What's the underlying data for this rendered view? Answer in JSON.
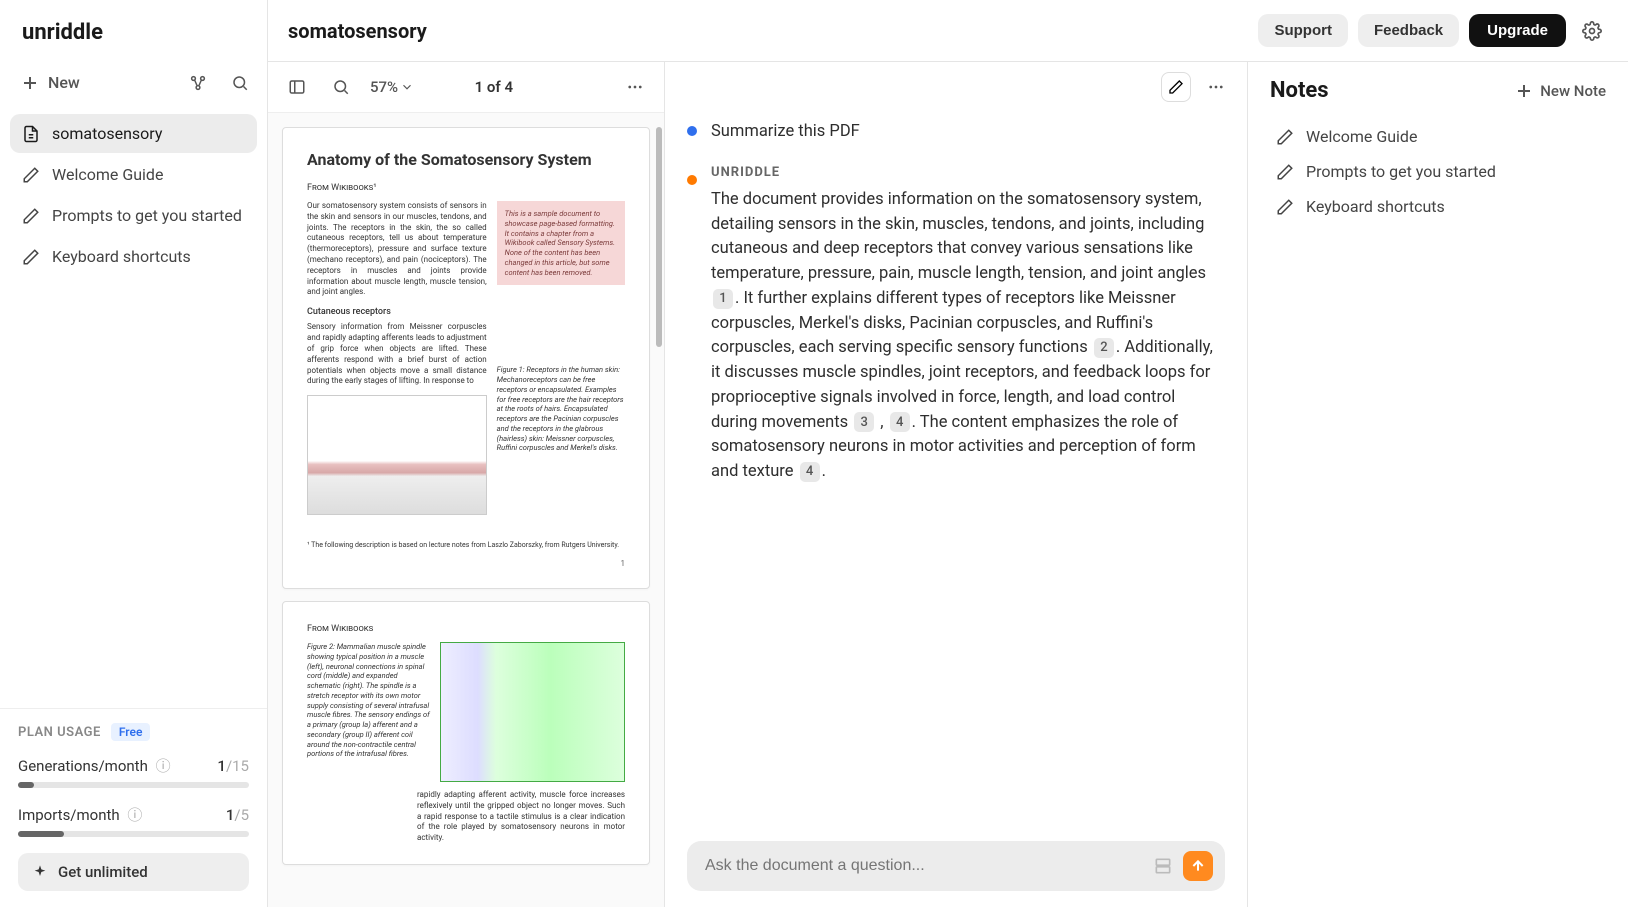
{
  "brand": "unriddle",
  "sidebar": {
    "new_label": "New",
    "items": [
      {
        "label": "somatosensory",
        "icon": "document",
        "active": true
      },
      {
        "label": "Welcome Guide",
        "icon": "pencil",
        "active": false
      },
      {
        "label": "Prompts to get you started",
        "icon": "pencil",
        "active": false
      },
      {
        "label": "Keyboard shortcuts",
        "icon": "pencil",
        "active": false
      }
    ],
    "plan_usage_label": "PLAN USAGE",
    "plan_badge": "Free",
    "generations_label": "Generations/month",
    "generations_used": "1",
    "generations_max": "/15",
    "generations_pct": 7,
    "imports_label": "Imports/month",
    "imports_used": "1",
    "imports_max": "/5",
    "imports_pct": 20,
    "get_unlimited": "Get unlimited"
  },
  "header": {
    "title": "somatosensory",
    "support": "Support",
    "feedback": "Feedback",
    "upgrade": "Upgrade"
  },
  "pdf": {
    "zoom": "57%",
    "page_indicator": "1 of 4",
    "page1": {
      "title": "Anatomy of the Somatosensory System",
      "subtitle": "From Wikibooks¹",
      "intro": "Our somatosensory system consists of sensors in the skin and sensors in our muscles, tendons, and joints. The receptors in the skin, the so called cutaneous receptors, tell us about temperature (thermoreceptors), pressure and surface texture (mechano receptors), and pain (nociceptors). The receptors in muscles and joints provide information about muscle length, muscle tension, and joint angles.",
      "note": "This is a sample document to showcase page-based formatting. It contains a chapter from a Wikibook called Sensory Systems. None of the content has been changed in this article, but some content has been removed.",
      "section1": "Cutaneous receptors",
      "section1_body": "Sensory information from Meissner corpuscles and rapidly adapting afferents leads to adjustment of grip force when objects are lifted. These afferents respond with a brief burst of action potentials when objects move a small distance during the early stages of lifting. In response to",
      "fig1_caption": "Figure 1:  Receptors in the human skin: Mechanoreceptors can be free receptors or encapsulated. Examples for free receptors are the hair receptors at the roots of hairs. Encapsulated receptors are the Pacinian corpuscles and the receptors in the glabrous (hairless) skin: Meissner corpuscles, Ruffini corpuscles and Merkel's disks.",
      "footnote": "¹ The following description is based on lecture notes from Laszlo Zaborszky, from Rutgers University.",
      "pgnum": "1"
    },
    "page2": {
      "subtitle": "From Wikibooks",
      "fig2_caption": "Figure 2:  Mammalian muscle spindle showing typical position in a muscle (left), neuronal connections in spinal cord (middle) and expanded schematic (right). The spindle is a stretch receptor with its own motor supply consisting of several intrafusal muscle fibres. The sensory endings of a primary (group Ia) afferent and a secondary (group II) afferent coil around the non-contractile central portions of the intrafusal fibres.",
      "body_cont": "rapidly adapting afferent activity, muscle force increases reflexively until the gripped object no longer moves. Such a rapid response to a tactile stimulus is a clear indication of the role played by somatosensory neurons in motor activity."
    }
  },
  "chat": {
    "user_message": "Summarize this PDF",
    "ai_label": "UNRIDDLE",
    "ai_message_p1": "The document provides information on the somatosensory system, detailing sensors in the skin, muscles, tendons, and joints, including cutaneous and deep receptors that convey various sensations like temperature, pressure, pain, muscle length, tension, and joint angles ",
    "cite1": "1",
    "ai_message_p2": ". It further explains different types of receptors like Meissner corpuscles, Merkel's disks, Pacinian corpuscles, and Ruffini's corpuscles, each serving specific sensory functions ",
    "cite2": "2",
    "ai_message_p3": ". Additionally, it discusses muscle spindles, joint receptors, and feedback loops for proprioceptive signals involved in force, length, and load control during movements ",
    "cite3": "3",
    "ai_message_sep": " , ",
    "cite4": "4",
    "ai_message_p4": ". The content emphasizes the role of somatosensory neurons in motor activities and perception of form and texture ",
    "cite5": "4",
    "ai_message_p5": ".",
    "input_placeholder": "Ask the document a question..."
  },
  "notes": {
    "title": "Notes",
    "new_note": "New Note",
    "items": [
      {
        "label": "Welcome Guide"
      },
      {
        "label": "Prompts to get you started"
      },
      {
        "label": "Keyboard shortcuts"
      }
    ]
  }
}
